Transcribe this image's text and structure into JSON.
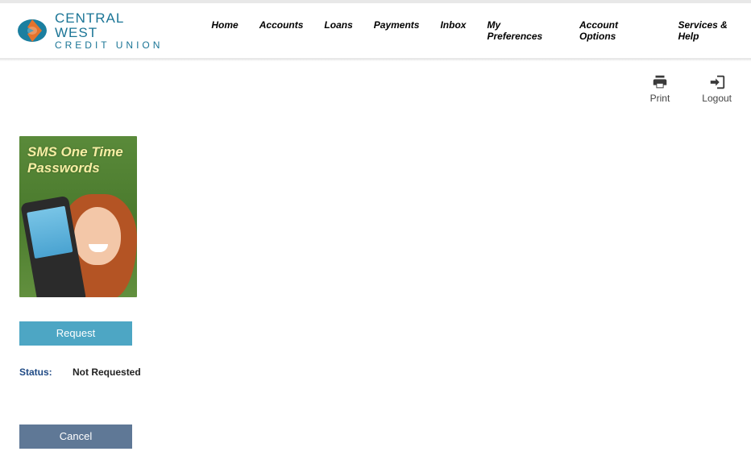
{
  "brand": {
    "line1": "CENTRAL WEST",
    "line2": "CREDIT UNION"
  },
  "nav": {
    "items": [
      {
        "label": "Home"
      },
      {
        "label": "Accounts"
      },
      {
        "label": "Loans"
      },
      {
        "label": "Payments"
      },
      {
        "label": "Inbox"
      },
      {
        "label": "My Preferences"
      },
      {
        "label": "Account Options"
      },
      {
        "label": "Services & Help"
      }
    ]
  },
  "toolbar": {
    "print_label": "Print",
    "logout_label": "Logout"
  },
  "promo": {
    "title": "SMS One Time Passwords"
  },
  "buttons": {
    "request_label": "Request",
    "cancel_label": "Cancel"
  },
  "status": {
    "label": "Status:",
    "value": "Not Requested"
  }
}
